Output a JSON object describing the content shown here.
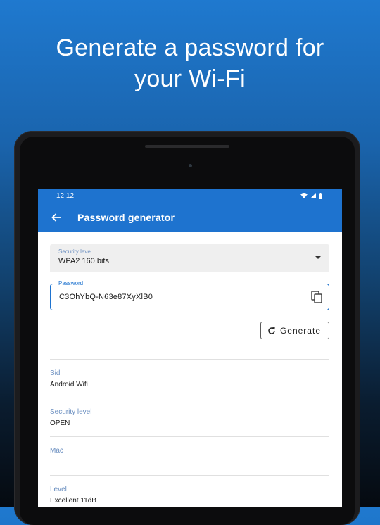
{
  "headline": {
    "line1": "Generate a password for",
    "line2": "your Wi-Fi"
  },
  "status_bar": {
    "time": "12:12"
  },
  "app_bar": {
    "title": "Password generator"
  },
  "security_select": {
    "label": "Security level",
    "value": "WPA2 160 bits"
  },
  "password_field": {
    "label": "Password",
    "value": "C3OhYbQ-N63e87XyXlB0"
  },
  "generate_button": {
    "label": "Generate"
  },
  "info": [
    {
      "label": "Sid",
      "value": "Android Wifi"
    },
    {
      "label": "Security level",
      "value": "OPEN"
    },
    {
      "label": "Mac",
      "value": ""
    },
    {
      "label": "Level",
      "value": "Excellent 11dB"
    }
  ],
  "colors": {
    "primary": "#1e73cf",
    "label": "#6b8fc0"
  }
}
